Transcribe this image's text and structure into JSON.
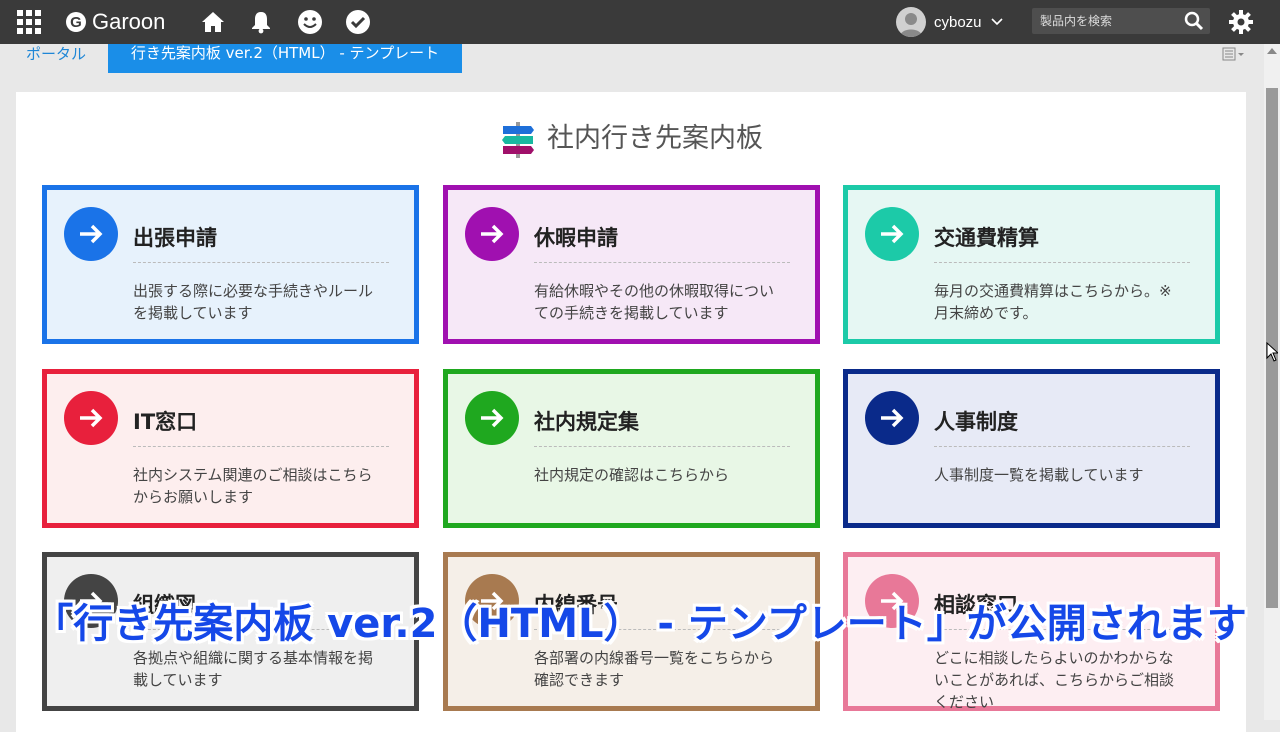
{
  "topbar": {
    "logo_letter": "G",
    "logo_text": "Garoon",
    "user_name": "cybozu",
    "search_placeholder": "製品内を検索"
  },
  "tabs": {
    "portal": "ポータル",
    "active": "行き先案内板 ver.2（HTML） - テンプレート"
  },
  "page_title": "社内行き先案内板",
  "cards": [
    {
      "title": "出張申請",
      "desc": "出張する際に必要な手続きやルールを掲載しています",
      "color": "#1a73e8",
      "bg": "#e7f2fc"
    },
    {
      "title": "休暇申請",
      "desc": "有給休暇やその他の休暇取得についての手続きを掲載しています",
      "color": "#a010b0",
      "bg": "#f6e8f7"
    },
    {
      "title": "交通費精算",
      "desc": "毎月の交通費精算はこちらから。※月末締めです。",
      "color": "#1ccaa8",
      "bg": "#e6f7f3"
    },
    {
      "title": "IT窓口",
      "desc": "社内システム関連のご相談はこちらからお願いします",
      "color": "#e8203c",
      "bg": "#fdeeee"
    },
    {
      "title": "社内規定集",
      "desc": "社内規定の確認はこちらから",
      "color": "#1fa81f",
      "bg": "#e8f7e6"
    },
    {
      "title": "人事制度",
      "desc": "人事制度一覧を掲載しています",
      "color": "#0a2a8a",
      "bg": "#e7eaf6"
    },
    {
      "title": "組織図",
      "desc": "各拠点や組織に関する基本情報を掲載しています",
      "color": "#444444",
      "bg": "#efefef"
    },
    {
      "title": "内線番号",
      "desc": "各部署の内線番号一覧をこちらから確認できます",
      "color": "#a87a50",
      "bg": "#f5efe8"
    },
    {
      "title": "相談窓口",
      "desc": "どこに相談したらよいのかわからないことがあれば、こちらからご相談ください",
      "color": "#e87898",
      "bg": "#fdeef2"
    }
  ],
  "caption": "「行き先案内板 ver.2（HTML） - テンプレート」が公開されます"
}
